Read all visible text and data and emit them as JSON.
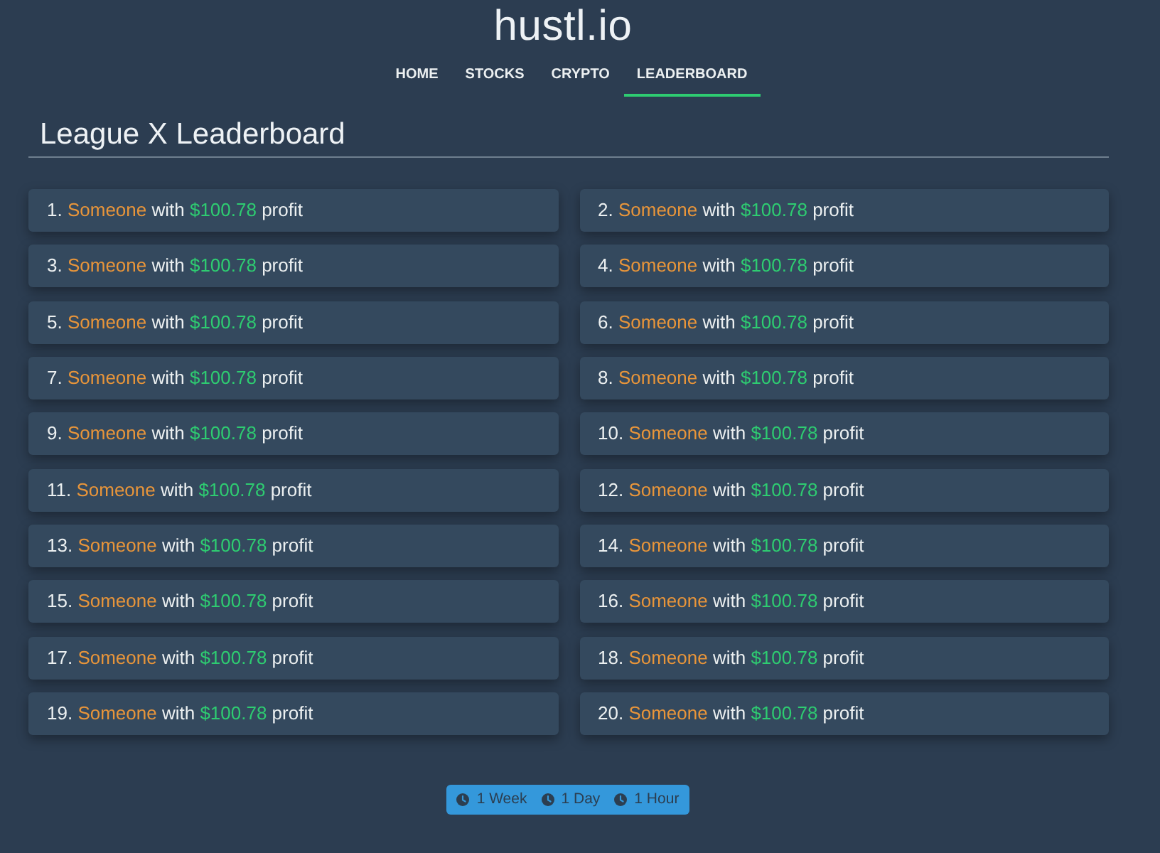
{
  "header": {
    "logo": "hustl.io"
  },
  "nav": {
    "tabs": [
      {
        "label": "HOME",
        "selected": false
      },
      {
        "label": "STOCKS",
        "selected": false
      },
      {
        "label": "CRYPTO",
        "selected": false
      },
      {
        "label": "LEADERBOARD",
        "selected": true
      }
    ]
  },
  "leaderboard": {
    "title": "League X Leaderboard",
    "entries": [
      {
        "rank": "1.",
        "name": "Someone",
        "connector": "with",
        "amount": "$100.78",
        "suffix": "profit"
      },
      {
        "rank": "2.",
        "name": "Someone",
        "connector": "with",
        "amount": "$100.78",
        "suffix": "profit"
      },
      {
        "rank": "3.",
        "name": "Someone",
        "connector": "with",
        "amount": "$100.78",
        "suffix": "profit"
      },
      {
        "rank": "4.",
        "name": "Someone",
        "connector": "with",
        "amount": "$100.78",
        "suffix": "profit"
      },
      {
        "rank": "5.",
        "name": "Someone",
        "connector": "with",
        "amount": "$100.78",
        "suffix": "profit"
      },
      {
        "rank": "6.",
        "name": "Someone",
        "connector": "with",
        "amount": "$100.78",
        "suffix": "profit"
      },
      {
        "rank": "7.",
        "name": "Someone",
        "connector": "with",
        "amount": "$100.78",
        "suffix": "profit"
      },
      {
        "rank": "8.",
        "name": "Someone",
        "connector": "with",
        "amount": "$100.78",
        "suffix": "profit"
      },
      {
        "rank": "9.",
        "name": "Someone",
        "connector": "with",
        "amount": "$100.78",
        "suffix": "profit"
      },
      {
        "rank": "10.",
        "name": "Someone",
        "connector": "with",
        "amount": "$100.78",
        "suffix": "profit"
      },
      {
        "rank": "11.",
        "name": "Someone",
        "connector": "with",
        "amount": "$100.78",
        "suffix": "profit"
      },
      {
        "rank": "12.",
        "name": "Someone",
        "connector": "with",
        "amount": "$100.78",
        "suffix": "profit"
      },
      {
        "rank": "13.",
        "name": "Someone",
        "connector": "with",
        "amount": "$100.78",
        "suffix": "profit"
      },
      {
        "rank": "14.",
        "name": "Someone",
        "connector": "with",
        "amount": "$100.78",
        "suffix": "profit"
      },
      {
        "rank": "15.",
        "name": "Someone",
        "connector": "with",
        "amount": "$100.78",
        "suffix": "profit"
      },
      {
        "rank": "16.",
        "name": "Someone",
        "connector": "with",
        "amount": "$100.78",
        "suffix": "profit"
      },
      {
        "rank": "17.",
        "name": "Someone",
        "connector": "with",
        "amount": "$100.78",
        "suffix": "profit"
      },
      {
        "rank": "18.",
        "name": "Someone",
        "connector": "with",
        "amount": "$100.78",
        "suffix": "profit"
      },
      {
        "rank": "19.",
        "name": "Someone",
        "connector": "with",
        "amount": "$100.78",
        "suffix": "profit"
      },
      {
        "rank": "20.",
        "name": "Someone",
        "connector": "with",
        "amount": "$100.78",
        "suffix": "profit"
      }
    ]
  },
  "time_range": {
    "buttons": [
      {
        "label": "1 Week",
        "selected": false
      },
      {
        "label": "1 Day",
        "selected": false
      },
      {
        "label": "1 Hour",
        "selected": false
      }
    ]
  }
}
